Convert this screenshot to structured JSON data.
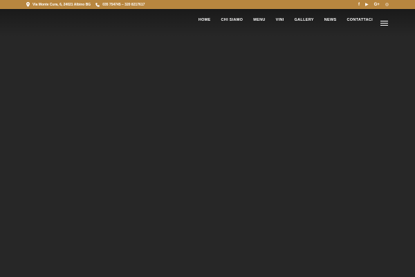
{
  "topbar": {
    "address": "Via Monte Cura, 6, 24021 Albino BG",
    "phone": "035 754745 – 320 8217617",
    "address_icon": "map-marker-icon",
    "phone_icon": "phone-icon",
    "background_color": "#b8863f",
    "social": [
      {
        "name": "facebook-icon",
        "glyph": "f"
      },
      {
        "name": "youtube-icon",
        "glyph": "▶"
      },
      {
        "name": "google-plus-icon",
        "glyph": "G+"
      },
      {
        "name": "tripadvisor-icon",
        "glyph": "◎"
      }
    ]
  },
  "nav": {
    "items": [
      "HOME",
      "CHI SIAMO",
      "MENU",
      "VINI",
      "GALLERY",
      "NEWS",
      "CONTATTACI"
    ],
    "menu_icon": "hamburger-menu-icon"
  },
  "colors": {
    "page_background": "#272727",
    "header_background": "#1a1a1a",
    "text": "#ffffff"
  }
}
